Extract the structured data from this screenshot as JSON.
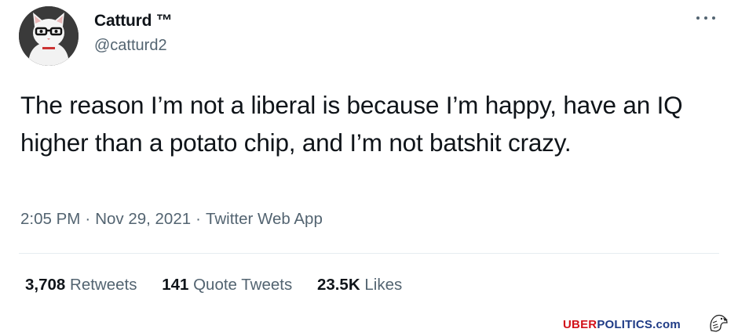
{
  "author": {
    "display_name": "Catturd ™",
    "handle": "@catturd2",
    "avatar": "cat-with-glasses-avatar"
  },
  "menu_icon": "more-options-icon",
  "tweet": {
    "text": "The reason I’m not a liberal is because I’m happy, have an IQ higher than a potato chip, and I’m not batshit crazy.",
    "time": "2:05 PM",
    "date": "Nov 29, 2021",
    "source": "Twitter Web App",
    "separator": "·"
  },
  "stats": {
    "retweets": {
      "count": "3,708",
      "label": "Retweets"
    },
    "quote_tweets": {
      "count": "141",
      "label": "Quote Tweets"
    },
    "likes": {
      "count": "23.5K",
      "label": "Likes"
    }
  },
  "watermark": {
    "part1": "UBER",
    "part2": "POLITICS",
    "part3": ".com",
    "color1": "#d2121a",
    "color2": "#1f3b86",
    "icon": "eagle-icon"
  },
  "colors": {
    "text_primary": "#0f1419",
    "text_secondary": "#536471",
    "divider": "#e6ecf0"
  }
}
